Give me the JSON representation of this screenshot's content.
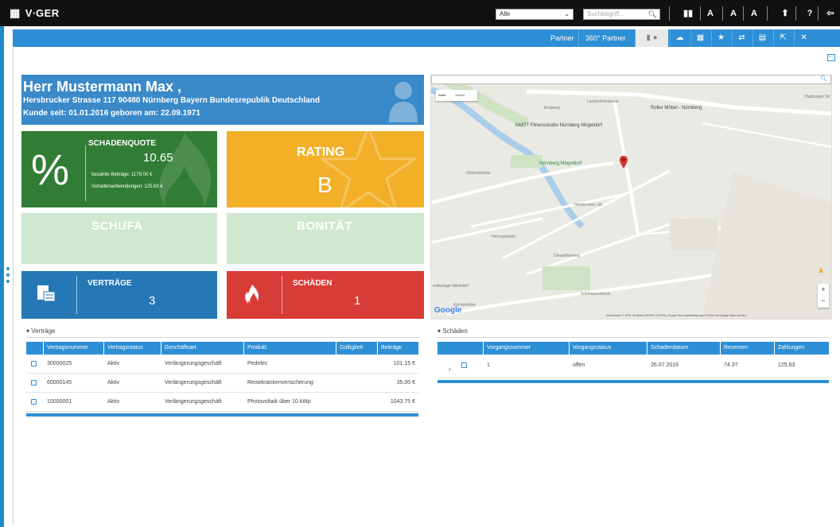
{
  "topbar": {
    "logo": "V∙GER",
    "filter": "Alle",
    "search_placeholder": "Suchbegriff...",
    "icons": [
      "quickaccess-icon",
      "font-increase-icon",
      "font-normal-icon",
      "font-decrease-icon",
      "upload-icon",
      "help-icon",
      "logout-icon"
    ]
  },
  "toolbar": {
    "partner": "Partner",
    "partner360": "360° Partner"
  },
  "customer": {
    "name": "Herr Mustermann Max ,",
    "address": "Hersbrucker Strasse 117  90480  Nürnberg  Bayern  Bundesrepublik Deutschland",
    "since": "Kunde seit:  01.01.2016  geboren am:  22.09.1971"
  },
  "tiles": {
    "quote": {
      "title": "SCHADENQUOTE",
      "value": "10.65",
      "paid_label": "bezahlte Beiträge:",
      "paid_value": "1179.00 €",
      "damage_label": "Schadenaufwendungen:",
      "damage_value": "125.63 €",
      "symbol": "%"
    },
    "rating": {
      "title": "RATING",
      "value": "B"
    },
    "schufa": {
      "title": "SCHUFA"
    },
    "bonitat": {
      "title": "BONITÄT"
    },
    "vertrage": {
      "title": "VERTRÄGE",
      "value": "3"
    },
    "schaden": {
      "title": "SCHÄDEN",
      "value": "1"
    }
  },
  "map": {
    "tab_map": "Karte",
    "tab_sat": "Satellit",
    "labels": [
      {
        "t": "Roller Möbel - Nürnberg"
      },
      {
        "t": "McFIT Fitnessstudio Nürnberg Mögeldorf"
      },
      {
        "t": "Nürnberg Mögeldorf"
      },
      {
        "t": "Laufamholzstraße"
      },
      {
        "t": "Bürgweg"
      },
      {
        "t": "Hersbrucker Str."
      },
      {
        "t": "Ostendstraße"
      },
      {
        "t": "Hapburger Str"
      },
      {
        "t": "Herzogstraße"
      },
      {
        "t": "Schmausenbuck"
      },
      {
        "t": "entlastage Ableitdorf"
      },
      {
        "t": "Kirchenhöhe"
      },
      {
        "t": "Diesselherweg"
      }
    ],
    "google": "Google",
    "footer": "Kartendaten © 2016 GeoBasis-DE/BKG (©2009), Google    Nutzungsbedingungen    Fehler bei Google Maps melden"
  },
  "vertrage": {
    "section": "Verträge",
    "columns": [
      "Vertragsnummer",
      "Vertragsstatus",
      "Geschäftsart",
      "Produkt",
      "Gültigkeit",
      "Beiträge"
    ],
    "rows": [
      [
        "30000025",
        "Aktiv",
        "Verlängerungsgeschäft",
        "Pedelec",
        "",
        "101.15 €"
      ],
      [
        "60000145",
        "Aktiv",
        "Verlängerungsgeschäft",
        "Reisekrankenversicherung",
        "",
        "35.00 €"
      ],
      [
        "10000001",
        "Aktiv",
        "Verlängerungsgeschäft",
        "Photovoltaik über 10 kWp",
        "",
        "1043.75 €"
      ]
    ]
  },
  "schaden": {
    "section": "Schäden",
    "columns": [
      "Vorgangsnummer",
      "Vorgangsstatus",
      "Schadendatum",
      "Reserven",
      "Zahlungen"
    ],
    "rows": [
      [
        "1",
        "offen",
        "26.07.2016",
        "74.37",
        "125.63"
      ]
    ]
  },
  "colors": {
    "accent": "#2d8fd5",
    "quote": "#327d36",
    "rating": "#f2b029",
    "vertrage": "#2577b5",
    "schaden": "#d83c37"
  }
}
